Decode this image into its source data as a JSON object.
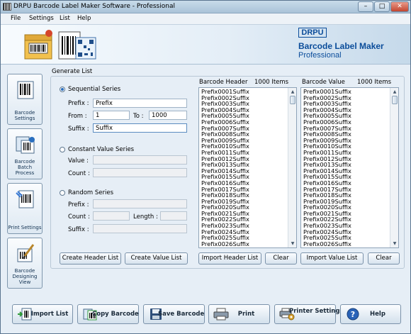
{
  "window": {
    "title": "DRPU Barcode Label Maker Software - Professional",
    "controls": {
      "minimize": "–",
      "maximize": "□",
      "close": "✕"
    }
  },
  "menu": [
    "File",
    "Settings",
    "List",
    "Help"
  ],
  "banner": {
    "logo_text": "DRPU",
    "product": "Barcode Label Maker",
    "edition": "Professional"
  },
  "sidebar": [
    {
      "label": "Barcode Settings",
      "icon": "barcode-settings-icon"
    },
    {
      "label": "Barcode Batch Process",
      "icon": "batch-process-icon"
    },
    {
      "label": "Print Settings",
      "icon": "print-settings-icon"
    },
    {
      "label": "Barcode Designing View",
      "icon": "designing-view-icon"
    }
  ],
  "generate": {
    "group_title": "Generate List",
    "sequential": {
      "label": "Sequential Series",
      "prefix_label": "Prefix :",
      "prefix_value": "Prefix",
      "from_label": "From :",
      "from_value": "1",
      "to_label": "To :",
      "to_value": "1000",
      "suffix_label": "Suffix :",
      "suffix_value": "Suffix"
    },
    "constant": {
      "label": "Constant Value Series",
      "value_label": "Value :",
      "count_label": "Count :"
    },
    "random": {
      "label": "Random Series",
      "prefix_label": "Prefix :",
      "count_label": "Count :",
      "length_label": "Length :",
      "suffix_label": "Suffix :"
    },
    "create_header_btn": "Create Header List",
    "create_value_btn": "Create Value List"
  },
  "header_list": {
    "title": "Barcode Header",
    "count": "1000 Items",
    "import_btn": "Import Header List",
    "clear_btn": "Clear",
    "items": [
      "Prefix0001Suffix",
      "Prefix0002Suffix",
      "Prefix0003Suffix",
      "Prefix0004Suffix",
      "Prefix0005Suffix",
      "Prefix0006Suffix",
      "Prefix0007Suffix",
      "Prefix0008Suffix",
      "Prefix0009Suffix",
      "Prefix0010Suffix",
      "Prefix0011Suffix",
      "Prefix0012Suffix",
      "Prefix0013Suffix",
      "Prefix0014Suffix",
      "Prefix0015Suffix",
      "Prefix0016Suffix",
      "Prefix0017Suffix",
      "Prefix0018Suffix",
      "Prefix0019Suffix",
      "Prefix0020Suffix",
      "Prefix0021Suffix",
      "Prefix0022Suffix",
      "Prefix0023Suffix",
      "Prefix0024Suffix",
      "Prefix0025Suffix",
      "Prefix0026Suffix"
    ]
  },
  "value_list": {
    "title": "Barcode Value",
    "count": "1000 Items",
    "import_btn": "Import Value List",
    "clear_btn": "Clear",
    "items": [
      "Prefix0001Suffix",
      "Prefix0002Suffix",
      "Prefix0003Suffix",
      "Prefix0004Suffix",
      "Prefix0005Suffix",
      "Prefix0006Suffix",
      "Prefix0007Suffix",
      "Prefix0008Suffix",
      "Prefix0009Suffix",
      "Prefix0010Suffix",
      "Prefix0011Suffix",
      "Prefix0012Suffix",
      "Prefix0013Suffix",
      "Prefix0014Suffix",
      "Prefix0015Suffix",
      "Prefix0016Suffix",
      "Prefix0017Suffix",
      "Prefix0018Suffix",
      "Prefix0019Suffix",
      "Prefix0020Suffix",
      "Prefix0021Suffix",
      "Prefix0022Suffix",
      "Prefix0023Suffix",
      "Prefix0024Suffix",
      "Prefix0025Suffix",
      "Prefix0026Suffix"
    ]
  },
  "toolbar": [
    {
      "label": "Import List",
      "icon": "import-list-icon"
    },
    {
      "label": "Copy Barcode",
      "icon": "copy-barcode-icon"
    },
    {
      "label": "Save Barcode",
      "icon": "save-icon"
    },
    {
      "label": "Print",
      "icon": "printer-icon"
    },
    {
      "label": "Printer Settings",
      "icon": "printer-settings-icon"
    },
    {
      "label": "Help",
      "icon": "help-icon"
    }
  ],
  "colors": {
    "brand_blue": "#0a4c9a",
    "radio_selected": "#2a6fbf"
  }
}
